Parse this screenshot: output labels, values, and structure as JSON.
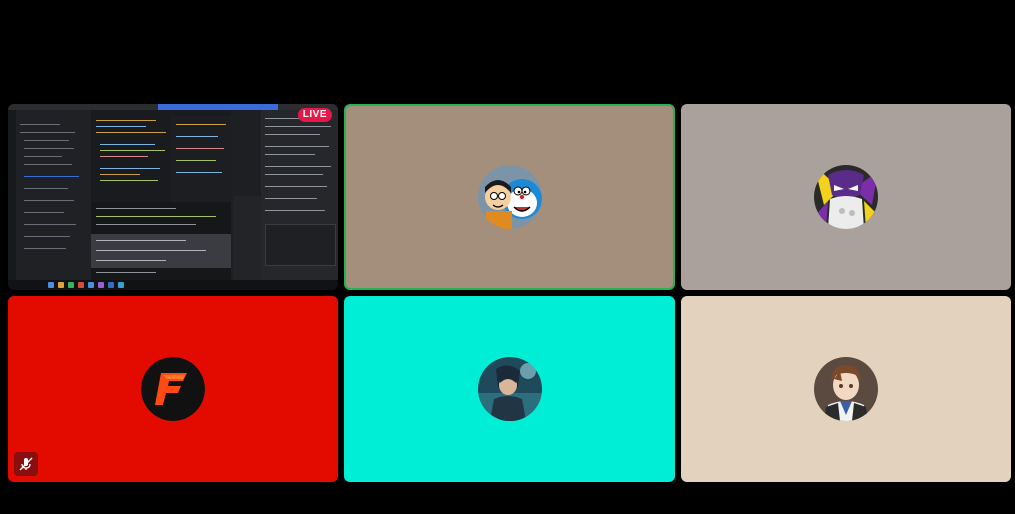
{
  "call": {
    "tiles": [
      {
        "kind": "screen-share",
        "badge": "LIVE",
        "background": "#1e1f22",
        "badge_color": "#e8174a"
      },
      {
        "kind": "participant",
        "avatar": "doraemon-nobita",
        "background": "#a38f7c",
        "speaking": true,
        "speaking_color": "#22b455"
      },
      {
        "kind": "participant",
        "avatar": "masked-character",
        "background": "#aaa19c"
      },
      {
        "kind": "participant",
        "avatar": "f-logo",
        "background": "#e30b00",
        "muted": true
      },
      {
        "kind": "participant",
        "avatar": "anime-character",
        "background": "#00edd6"
      },
      {
        "kind": "participant",
        "avatar": "suit-character",
        "background": "#e3d3be"
      }
    ]
  },
  "icons": {
    "mute": "microphone-muted-icon"
  }
}
